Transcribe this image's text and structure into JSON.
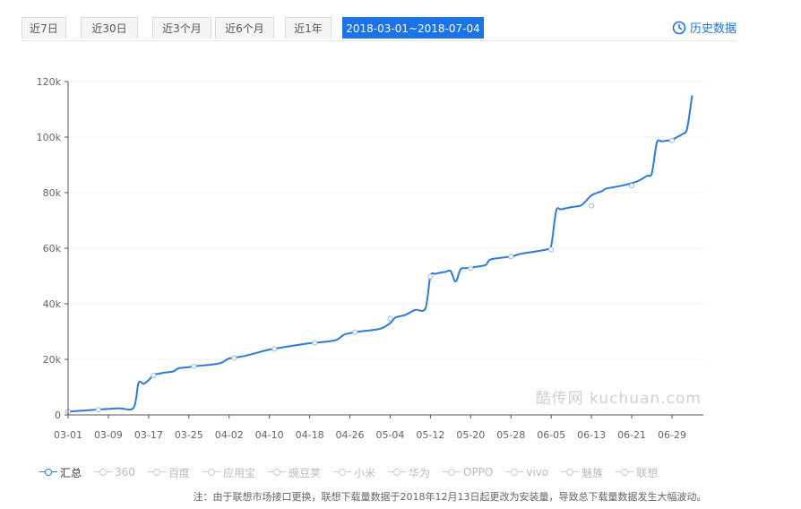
{
  "tabs": [
    {
      "label": "近7日"
    },
    {
      "label": "近30日"
    },
    {
      "label": "近3个月"
    },
    {
      "label": "近6个月"
    },
    {
      "label": "近1年"
    },
    {
      "label": "2018-03-01~2018-07-04",
      "active": true
    }
  ],
  "history_label": "历史数据",
  "watermark": "酷传网 kuchuan.com",
  "note": "注：由于联想市场接口更换，联想下载量数据于2018年12月13日起更改为安装量，导致总下载量数据发生大幅波动。",
  "legend": [
    {
      "label": "汇总",
      "active": true
    },
    {
      "label": "360",
      "active": false
    },
    {
      "label": "百度",
      "active": false
    },
    {
      "label": "应用宝",
      "active": false
    },
    {
      "label": "豌豆荚",
      "active": false
    },
    {
      "label": "小米",
      "active": false
    },
    {
      "label": "华为",
      "active": false
    },
    {
      "label": "OPPO",
      "active": false
    },
    {
      "label": "vivo",
      "active": false
    },
    {
      "label": "魅族",
      "active": false
    },
    {
      "label": "联想",
      "active": false
    }
  ],
  "colors": {
    "line": "#2b7bd8",
    "active_tab": "#1a73e8",
    "axis": "#555555",
    "grid": "#efefef"
  },
  "icons": {
    "history": "history-clock-icon"
  },
  "chart_data": {
    "type": "line",
    "title": "",
    "xlabel": "",
    "ylabel": "",
    "ylim": [
      0,
      120000
    ],
    "y_ticks": [
      "0",
      "20k",
      "40k",
      "60k",
      "80k",
      "100k",
      "120k"
    ],
    "y_tick_values": [
      0,
      20000,
      40000,
      60000,
      80000,
      100000,
      120000
    ],
    "x_tick_labels": [
      "03-01",
      "03-09",
      "03-17",
      "03-25",
      "04-02",
      "04-10",
      "04-18",
      "04-26",
      "05-04",
      "05-12",
      "05-20",
      "05-28",
      "06-05",
      "06-13",
      "06-21",
      "06-29"
    ],
    "x_tick_days": [
      0,
      8,
      16,
      24,
      32,
      40,
      48,
      56,
      64,
      72,
      80,
      88,
      96,
      104,
      112,
      120
    ],
    "grid": true,
    "legend_position": "bottom",
    "series": [
      {
        "name": "汇总",
        "days": [
          0,
          5,
          10,
          13,
          14,
          15,
          16,
          17,
          18,
          19,
          20,
          21,
          22,
          24,
          25,
          30,
          32,
          35,
          40,
          45,
          48,
          53,
          55,
          58,
          62,
          64,
          65,
          67,
          69,
          71,
          72,
          73,
          75,
          76,
          77,
          78,
          79,
          80,
          81,
          83,
          84,
          88,
          90,
          95,
          96,
          97,
          98,
          100,
          102,
          104,
          106,
          107,
          110,
          113,
          115,
          116,
          117,
          118,
          120,
          121,
          122,
          123,
          124
        ],
        "values": [
          1200,
          1800,
          2400,
          2500,
          11500,
          11200,
          12500,
          14500,
          14800,
          15200,
          15400,
          15700,
          16800,
          17200,
          17500,
          18500,
          20300,
          21200,
          23500,
          25000,
          25800,
          26800,
          29000,
          30000,
          31000,
          33000,
          35000,
          36000,
          37800,
          38300,
          50000,
          50800,
          51500,
          51800,
          48000,
          52500,
          52800,
          53000,
          53300,
          54000,
          56000,
          57000,
          58000,
          59500,
          61000,
          73500,
          74000,
          74800,
          75500,
          79000,
          80500,
          81500,
          82500,
          84000,
          86000,
          87000,
          98000,
          98500,
          99000,
          100000,
          101000,
          103000,
          115000
        ]
      }
    ],
    "markers": [
      {
        "day": 0,
        "value": 1200
      },
      {
        "day": 6,
        "value": 1900
      },
      {
        "day": 17,
        "value": 14200
      },
      {
        "day": 25,
        "value": 17500
      },
      {
        "day": 33,
        "value": 20500
      },
      {
        "day": 41,
        "value": 23700
      },
      {
        "day": 49,
        "value": 26000
      },
      {
        "day": 57,
        "value": 29800
      },
      {
        "day": 64,
        "value": 34700
      },
      {
        "day": 72,
        "value": 49800
      },
      {
        "day": 80,
        "value": 52800
      },
      {
        "day": 88,
        "value": 57000
      },
      {
        "day": 96,
        "value": 59500
      },
      {
        "day": 104,
        "value": 75300
      },
      {
        "day": 112,
        "value": 82500
      },
      {
        "day": 120,
        "value": 98800
      }
    ]
  }
}
